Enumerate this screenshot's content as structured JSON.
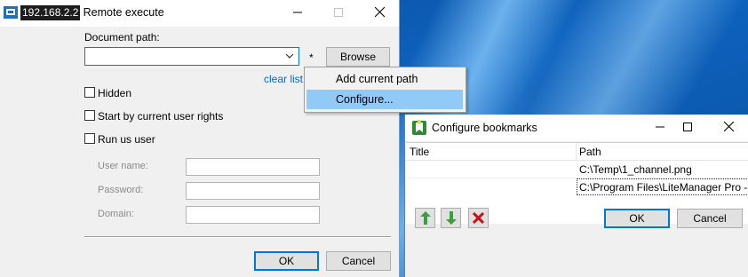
{
  "remote_window": {
    "title_ip": "192.168.2.2",
    "title_rest": "- Remote execute",
    "document_path_label": "Document path:",
    "document_path_value": "",
    "asterisk": "*",
    "browse_label": "Browse",
    "clear_list_label": "clear list",
    "hidden_label": "Hidden",
    "start_rights_label": "Start by current user rights",
    "run_as_label": "Run us user",
    "username_label": "User name:",
    "password_label": "Password:",
    "domain_label": "Domain:",
    "ok_label": "OK",
    "cancel_label": "Cancel"
  },
  "context_menu": {
    "items": [
      {
        "label": "Add current path",
        "selected": false
      },
      {
        "label": "Configure...",
        "selected": true
      }
    ]
  },
  "bookmarks_window": {
    "title": "Configure bookmarks",
    "columns": [
      "Title",
      "Path"
    ],
    "rows": [
      {
        "title": "",
        "path": "C:\\Temp\\1_channel.png"
      },
      {
        "title": "",
        "path": "C:\\Program Files\\LiteManager Pro - Server\\"
      }
    ],
    "ok_label": "OK",
    "cancel_label": "Cancel"
  },
  "colors": {
    "accent": "#0078d7",
    "link": "#0066cc",
    "menu_selection": "#91c9f7",
    "arrow_green": "#3aa03a",
    "delete_red": "#d01010"
  }
}
